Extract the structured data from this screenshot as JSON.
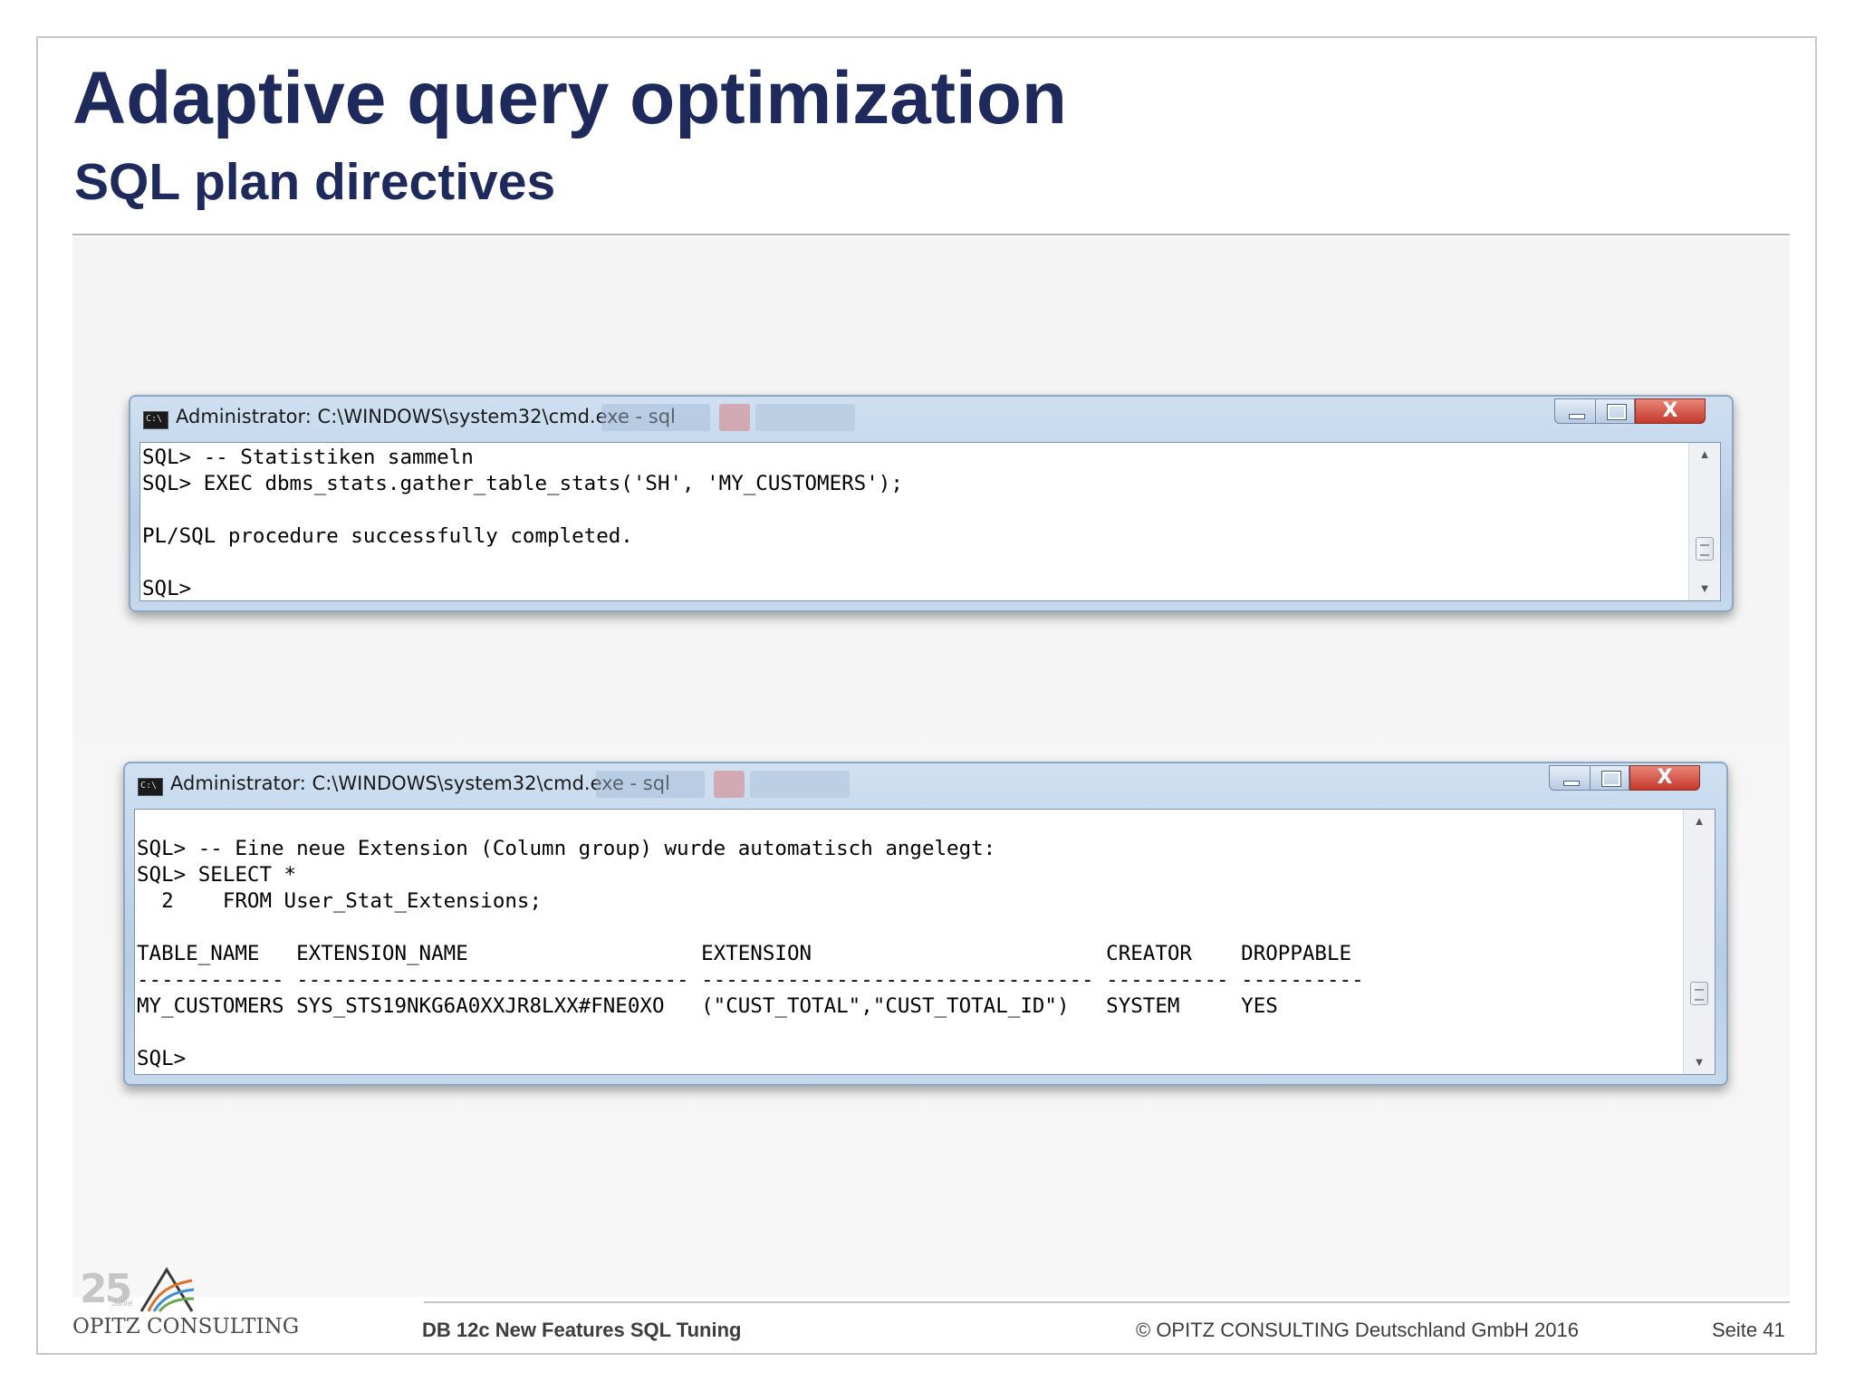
{
  "slide": {
    "title": "Adaptive query optimization",
    "subtitle": "SQL plan directives"
  },
  "windows": [
    {
      "title": "Administrator: C:\\WINDOWS\\system32\\cmd.exe - sql",
      "buttons": {
        "close": "X"
      },
      "console": "SQL> -- Statistiken sammeln\nSQL> EXEC dbms_stats.gather_table_stats('SH', 'MY_CUSTOMERS');\n\nPL/SQL procedure successfully completed.\n\nSQL>"
    },
    {
      "title": "Administrator: C:\\WINDOWS\\system32\\cmd.exe - sql",
      "buttons": {
        "close": "X"
      },
      "console": "\nSQL> -- Eine neue Extension (Column group) wurde automatisch angelegt:\nSQL> SELECT *\n  2    FROM User_Stat_Extensions;\n\nTABLE_NAME   EXTENSION_NAME                   EXTENSION                        CREATOR    DROPPABLE\n------------ -------------------------------- -------------------------------- ---------- ----------\nMY_CUSTOMERS SYS_STS19NKG6A0XXJR8LXX#FNE0XO   (\"CUST_TOTAL\",\"CUST_TOTAL_ID\")   SYSTEM     YES\n\nSQL>"
    }
  ],
  "footer": {
    "logo_number": "25",
    "logo_sub": "Jahre",
    "logo_text": "OPITZ CONSULTING",
    "title": "DB 12c New Features SQL Tuning",
    "copyright": "© OPITZ CONSULTING Deutschland GmbH 2016",
    "page": "Seite 41"
  },
  "colors": {
    "title": "#1f2a5c",
    "window_frame": "#b7cde6",
    "close_button": "#c4392a",
    "footer_text": "#3d3d3d"
  }
}
